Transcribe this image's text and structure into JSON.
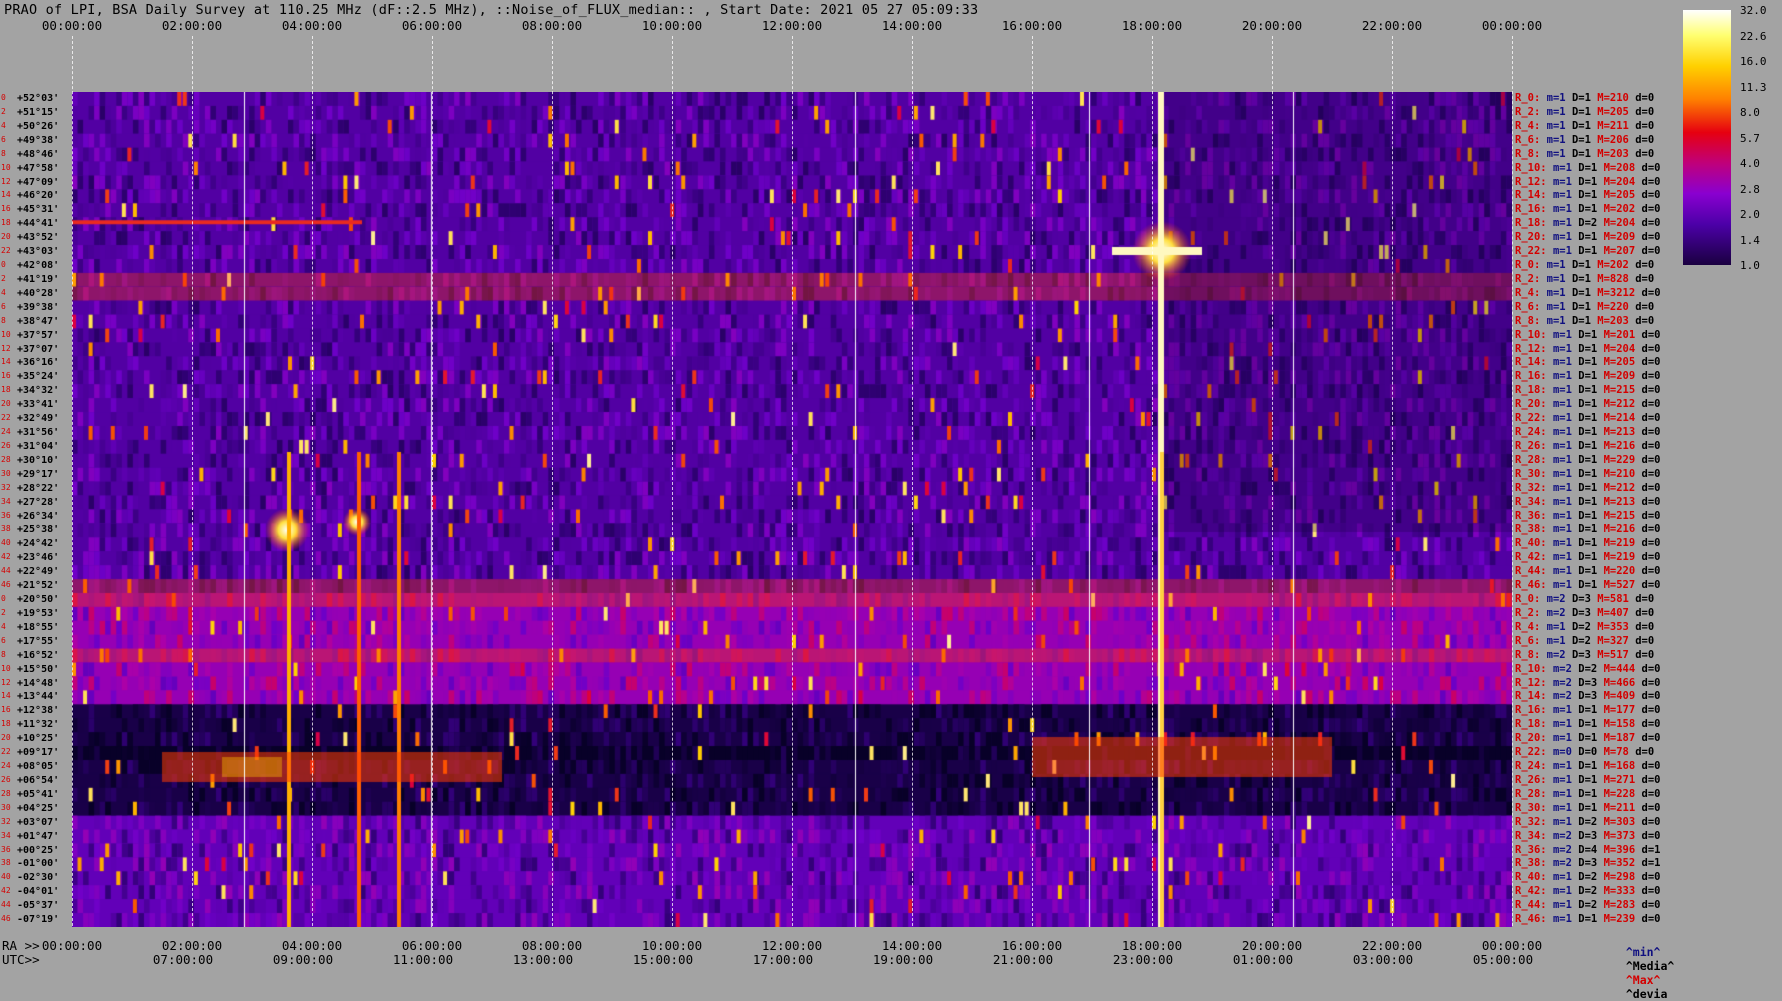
{
  "title": "PRAO of LPI, BSA Daily Survey at 110.25 MHz (dF::2.5 MHz), ::Noise_of_FLUX_median:: , Start Date: 2021 05 27 05:09:33",
  "top_ticks": [
    "00:00:00",
    "02:00:00",
    "04:00:00",
    "06:00:00",
    "08:00:00",
    "10:00:00",
    "12:00:00",
    "14:00:00",
    "16:00:00",
    "18:00:00",
    "20:00:00",
    "22:00:00",
    "00:00:00"
  ],
  "bottom_ra_prefix": "RA >>",
  "bottom_ra_ticks": [
    "00:00:00",
    "02:00:00",
    "04:00:00",
    "06:00:00",
    "08:00:00",
    "10:00:00",
    "12:00:00",
    "14:00:00",
    "16:00:00",
    "18:00:00",
    "20:00:00",
    "22:00:00",
    "00:00:00"
  ],
  "bottom_utc_prefix": "UTC>>",
  "bottom_utc_ticks": [
    "07:00:00",
    "09:00:00",
    "11:00:00",
    "13:00:00",
    "15:00:00",
    "17:00:00",
    "19:00:00",
    "21:00:00",
    "23:00:00",
    "01:00:00",
    "03:00:00",
    "05:00:00"
  ],
  "colorbar": {
    "ticks": [
      "32.0",
      "22.6",
      "16.0",
      "11.3",
      "8.0",
      "5.7",
      "4.0",
      "2.8",
      "2.0",
      "1.4",
      "1.0"
    ]
  },
  "legend": {
    "min": "^min^",
    "median": "^Media^",
    "max": "^Max^",
    "devia": "^devia"
  },
  "colors": {
    "background": "#a3a3a3",
    "label_red": "#d40000",
    "label_blue": "#101080"
  },
  "chart_data": {
    "type": "heatmap",
    "title": "PRAO of LPI, BSA Daily Survey at 110.25 MHz (dF::2.5 MHz), ::Noise_of_FLUX_median:: , Start Date: 2021 05 27 05:09:33",
    "x_axis_top": "RA 00:00:00 – 24:00:00",
    "x_axis_bottom": "UTC 05:09:33 start",
    "color_scale": "log",
    "color_range": [
      1.0,
      32.0
    ],
    "rows": [
      {
        "n": "0",
        "decl": "+52°03'",
        "r": "R_0:",
        "m": "1",
        "D": "1",
        "M": "210",
        "d": "0"
      },
      {
        "n": "2",
        "decl": "+51°15'",
        "r": "R_2:",
        "m": "1",
        "D": "1",
        "M": "205",
        "d": "0"
      },
      {
        "n": "4",
        "decl": "+50°26'",
        "r": "R_4:",
        "m": "1",
        "D": "1",
        "M": "211",
        "d": "0"
      },
      {
        "n": "6",
        "decl": "+49°38'",
        "r": "R_6:",
        "m": "1",
        "D": "1",
        "M": "206",
        "d": "0"
      },
      {
        "n": "8",
        "decl": "+48°46'",
        "r": "R_8:",
        "m": "1",
        "D": "1",
        "M": "203",
        "d": "0"
      },
      {
        "n": "10",
        "decl": "+47°58'",
        "r": "R_10:",
        "m": "1",
        "D": "1",
        "M": "208",
        "d": "0"
      },
      {
        "n": "12",
        "decl": "+47°09'",
        "r": "R_12:",
        "m": "1",
        "D": "1",
        "M": "204",
        "d": "0"
      },
      {
        "n": "14",
        "decl": "+46°20'",
        "r": "R_14:",
        "m": "1",
        "D": "1",
        "M": "205",
        "d": "0"
      },
      {
        "n": "16",
        "decl": "+45°31'",
        "r": "R_16:",
        "m": "1",
        "D": "1",
        "M": "202",
        "d": "0"
      },
      {
        "n": "18",
        "decl": "+44°41'",
        "r": "R_18:",
        "m": "1",
        "D": "2",
        "M": "204",
        "d": "0"
      },
      {
        "n": "20",
        "decl": "+43°52'",
        "r": "R_20:",
        "m": "1",
        "D": "1",
        "M": "209",
        "d": "0"
      },
      {
        "n": "22",
        "decl": "+43°03'",
        "r": "R_22:",
        "m": "1",
        "D": "1",
        "M": "207",
        "d": "0"
      },
      {
        "n": "0",
        "decl": "+42°08'",
        "r": "R_0:",
        "m": "1",
        "D": "1",
        "M": "202",
        "d": "0"
      },
      {
        "n": "2",
        "decl": "+41°19'",
        "r": "R_2:",
        "m": "1",
        "D": "1",
        "M": "828",
        "d": "0"
      },
      {
        "n": "4",
        "decl": "+40°28'",
        "r": "R_4:",
        "m": "1",
        "D": "1",
        "M": "3212",
        "d": "0"
      },
      {
        "n": "6",
        "decl": "+39°38'",
        "r": "R_6:",
        "m": "1",
        "D": "1",
        "M": "220",
        "d": "0"
      },
      {
        "n": "8",
        "decl": "+38°47'",
        "r": "R_8:",
        "m": "1",
        "D": "1",
        "M": "203",
        "d": "0"
      },
      {
        "n": "10",
        "decl": "+37°57'",
        "r": "R_10:",
        "m": "1",
        "D": "1",
        "M": "201",
        "d": "0"
      },
      {
        "n": "12",
        "decl": "+37°07'",
        "r": "R_12:",
        "m": "1",
        "D": "1",
        "M": "204",
        "d": "0"
      },
      {
        "n": "14",
        "decl": "+36°16'",
        "r": "R_14:",
        "m": "1",
        "D": "1",
        "M": "205",
        "d": "0"
      },
      {
        "n": "16",
        "decl": "+35°24'",
        "r": "R_16:",
        "m": "1",
        "D": "1",
        "M": "209",
        "d": "0"
      },
      {
        "n": "18",
        "decl": "+34°32'",
        "r": "R_18:",
        "m": "1",
        "D": "1",
        "M": "215",
        "d": "0"
      },
      {
        "n": "20",
        "decl": "+33°41'",
        "r": "R_20:",
        "m": "1",
        "D": "1",
        "M": "212",
        "d": "0"
      },
      {
        "n": "22",
        "decl": "+32°49'",
        "r": "R_22:",
        "m": "1",
        "D": "1",
        "M": "214",
        "d": "0"
      },
      {
        "n": "24",
        "decl": "+31°56'",
        "r": "R_24:",
        "m": "1",
        "D": "1",
        "M": "213",
        "d": "0"
      },
      {
        "n": "26",
        "decl": "+31°04'",
        "r": "R_26:",
        "m": "1",
        "D": "1",
        "M": "216",
        "d": "0"
      },
      {
        "n": "28",
        "decl": "+30°10'",
        "r": "R_28:",
        "m": "1",
        "D": "1",
        "M": "229",
        "d": "0"
      },
      {
        "n": "30",
        "decl": "+29°17'",
        "r": "R_30:",
        "m": "1",
        "D": "1",
        "M": "210",
        "d": "0"
      },
      {
        "n": "32",
        "decl": "+28°22'",
        "r": "R_32:",
        "m": "1",
        "D": "1",
        "M": "212",
        "d": "0"
      },
      {
        "n": "34",
        "decl": "+27°28'",
        "r": "R_34:",
        "m": "1",
        "D": "1",
        "M": "213",
        "d": "0"
      },
      {
        "n": "36",
        "decl": "+26°34'",
        "r": "R_36:",
        "m": "1",
        "D": "1",
        "M": "215",
        "d": "0"
      },
      {
        "n": "38",
        "decl": "+25°38'",
        "r": "R_38:",
        "m": "1",
        "D": "1",
        "M": "216",
        "d": "0"
      },
      {
        "n": "40",
        "decl": "+24°42'",
        "r": "R_40:",
        "m": "1",
        "D": "1",
        "M": "219",
        "d": "0"
      },
      {
        "n": "42",
        "decl": "+23°46'",
        "r": "R_42:",
        "m": "1",
        "D": "1",
        "M": "219",
        "d": "0"
      },
      {
        "n": "44",
        "decl": "+22°49'",
        "r": "R_44:",
        "m": "1",
        "D": "1",
        "M": "220",
        "d": "0"
      },
      {
        "n": "46",
        "decl": "+21°52'",
        "r": "R_46:",
        "m": "1",
        "D": "1",
        "M": "527",
        "d": "0"
      },
      {
        "n": "0",
        "decl": "+20°50'",
        "r": "R_0:",
        "m": "2",
        "D": "3",
        "M": "581",
        "d": "0"
      },
      {
        "n": "2",
        "decl": "+19°53'",
        "r": "R_2:",
        "m": "2",
        "D": "3",
        "M": "407",
        "d": "0"
      },
      {
        "n": "4",
        "decl": "+18°55'",
        "r": "R_4:",
        "m": "1",
        "D": "2",
        "M": "353",
        "d": "0"
      },
      {
        "n": "6",
        "decl": "+17°55'",
        "r": "R_6:",
        "m": "1",
        "D": "2",
        "M": "327",
        "d": "0"
      },
      {
        "n": "8",
        "decl": "+16°52'",
        "r": "R_8:",
        "m": "2",
        "D": "3",
        "M": "517",
        "d": "0"
      },
      {
        "n": "10",
        "decl": "+15°50'",
        "r": "R_10:",
        "m": "2",
        "D": "2",
        "M": "444",
        "d": "0"
      },
      {
        "n": "12",
        "decl": "+14°48'",
        "r": "R_12:",
        "m": "2",
        "D": "3",
        "M": "466",
        "d": "0"
      },
      {
        "n": "14",
        "decl": "+13°44'",
        "r": "R_14:",
        "m": "2",
        "D": "3",
        "M": "409",
        "d": "0"
      },
      {
        "n": "16",
        "decl": "+12°38'",
        "r": "R_16:",
        "m": "1",
        "D": "1",
        "M": "177",
        "d": "0"
      },
      {
        "n": "18",
        "decl": "+11°32'",
        "r": "R_18:",
        "m": "1",
        "D": "1",
        "M": "158",
        "d": "0"
      },
      {
        "n": "20",
        "decl": "+10°25'",
        "r": "R_20:",
        "m": "1",
        "D": "1",
        "M": "187",
        "d": "0"
      },
      {
        "n": "22",
        "decl": "+09°17'",
        "r": "R_22:",
        "m": "0",
        "D": "0",
        "M": "78",
        "d": "0"
      },
      {
        "n": "24",
        "decl": "+08°05'",
        "r": "R_24:",
        "m": "1",
        "D": "1",
        "M": "168",
        "d": "0"
      },
      {
        "n": "26",
        "decl": "+06°54'",
        "r": "R_26:",
        "m": "1",
        "D": "1",
        "M": "271",
        "d": "0"
      },
      {
        "n": "28",
        "decl": "+05°41'",
        "r": "R_28:",
        "m": "1",
        "D": "1",
        "M": "228",
        "d": "0"
      },
      {
        "n": "30",
        "decl": "+04°25'",
        "r": "R_30:",
        "m": "1",
        "D": "1",
        "M": "211",
        "d": "0"
      },
      {
        "n": "32",
        "decl": "+03°07'",
        "r": "R_32:",
        "m": "1",
        "D": "2",
        "M": "303",
        "d": "0"
      },
      {
        "n": "34",
        "decl": "+01°47'",
        "r": "R_34:",
        "m": "2",
        "D": "3",
        "M": "373",
        "d": "0"
      },
      {
        "n": "36",
        "decl": "+00°25'",
        "r": "R_36:",
        "m": "2",
        "D": "4",
        "M": "396",
        "d": "1"
      },
      {
        "n": "38",
        "decl": "-01°00'",
        "r": "R_38:",
        "m": "2",
        "D": "3",
        "M": "352",
        "d": "1"
      },
      {
        "n": "40",
        "decl": "-02°30'",
        "r": "R_40:",
        "m": "1",
        "D": "2",
        "M": "298",
        "d": "0"
      },
      {
        "n": "42",
        "decl": "-04°01'",
        "r": "R_42:",
        "m": "1",
        "D": "2",
        "M": "333",
        "d": "0"
      },
      {
        "n": "44",
        "decl": "-05°37'",
        "r": "R_44:",
        "m": "1",
        "D": "2",
        "M": "283",
        "d": "0"
      },
      {
        "n": "46",
        "decl": "-07°19'",
        "r": "R_46:",
        "m": "1",
        "D": "1",
        "M": "239",
        "d": "0"
      }
    ]
  }
}
